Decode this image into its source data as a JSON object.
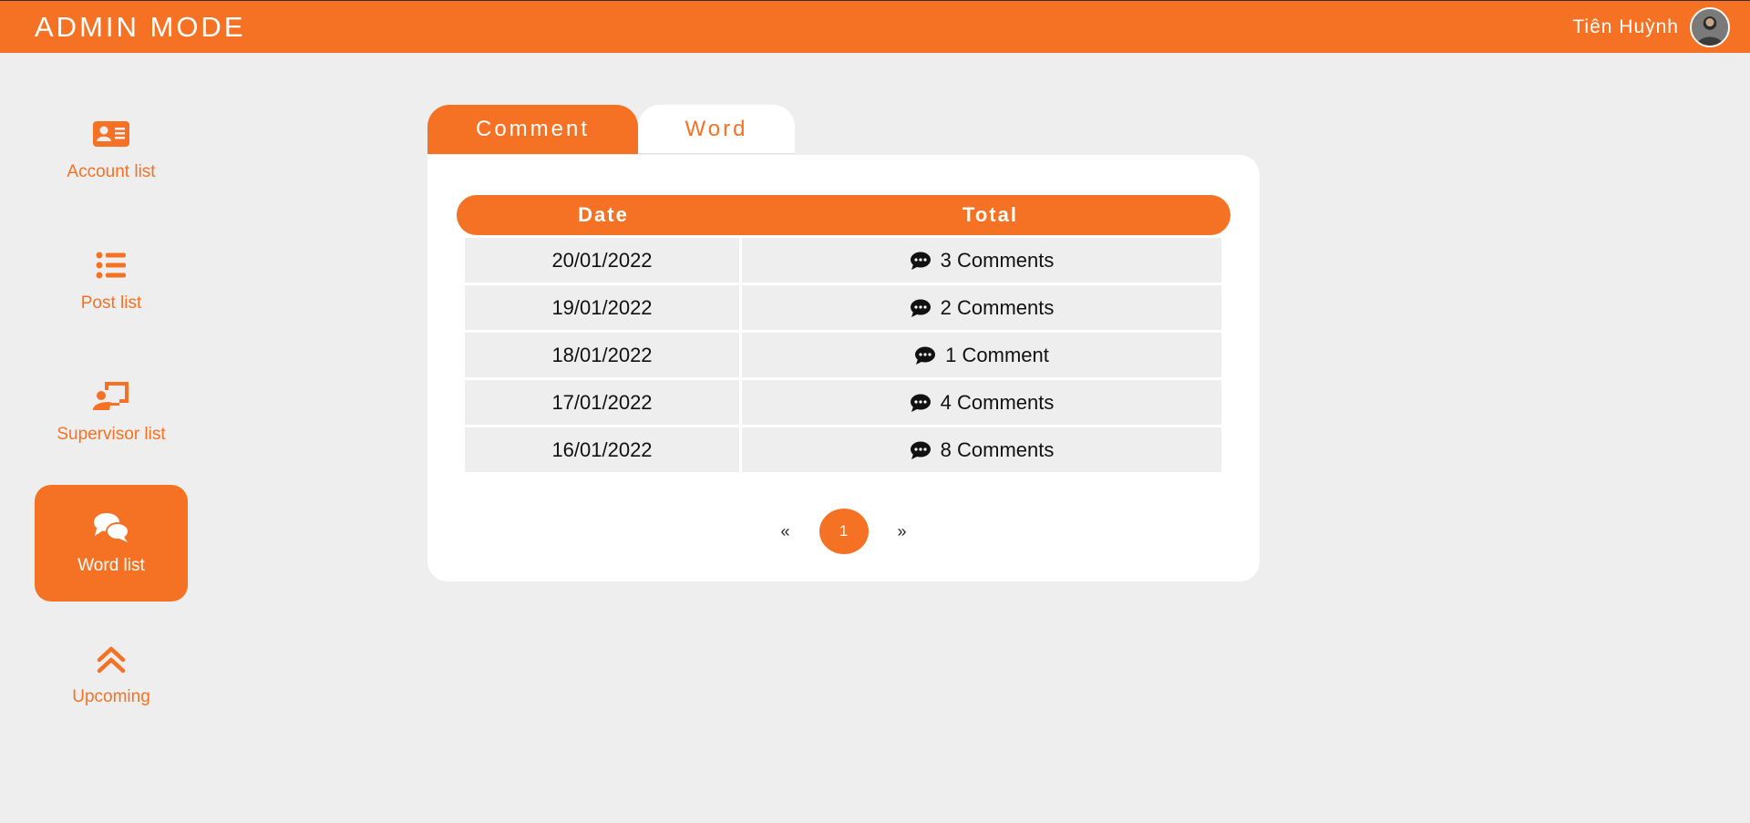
{
  "header": {
    "brand": "ADMIN MODE",
    "user_name": "Tiên Huỳnh"
  },
  "colors": {
    "accent": "#f57224",
    "background": "#eeeeee",
    "card": "#ffffff"
  },
  "sidebar": {
    "items": [
      {
        "label": "Account list",
        "icon": "id-card-icon",
        "active": false
      },
      {
        "label": "Post list",
        "icon": "list-icon",
        "active": false
      },
      {
        "label": "Supervisor list",
        "icon": "chalkboard-teacher-icon",
        "active": false
      },
      {
        "label": "Word list",
        "icon": "comments-icon",
        "active": true
      },
      {
        "label": "Upcoming",
        "icon": "double-chevron-up-icon",
        "active": false
      }
    ]
  },
  "tabs": [
    {
      "label": "Comment",
      "active": true
    },
    {
      "label": "Word",
      "active": false
    }
  ],
  "table": {
    "headers": {
      "date": "Date",
      "total": "Total"
    },
    "rows": [
      {
        "date": "20/01/2022",
        "total": "3 Comments"
      },
      {
        "date": "19/01/2022",
        "total": "2 Comments"
      },
      {
        "date": "18/01/2022",
        "total": "1 Comment"
      },
      {
        "date": "17/01/2022",
        "total": "4 Comments"
      },
      {
        "date": "16/01/2022",
        "total": "8 Comments"
      }
    ]
  },
  "pagination": {
    "prev": "«",
    "current": "1",
    "next": "»"
  }
}
